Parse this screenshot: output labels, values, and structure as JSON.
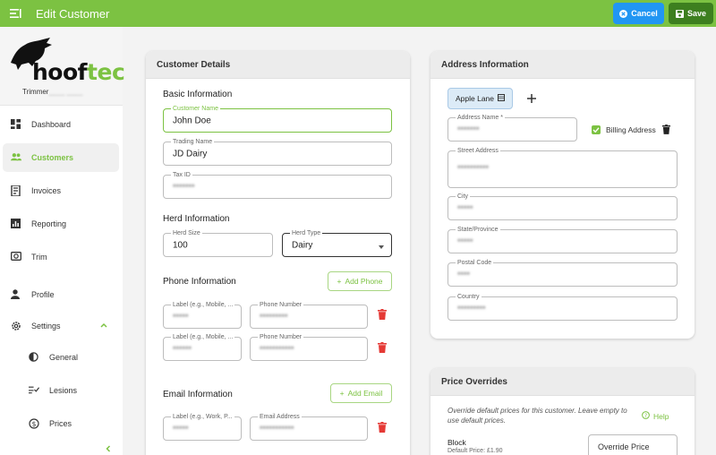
{
  "topbar": {
    "title": "Edit Customer",
    "cancel_label": "Cancel",
    "save_label": "Save"
  },
  "sidebar": {
    "logo_prefix": "hoof",
    "logo_suffix": "tec",
    "subtitle": "Trimmer",
    "items": [
      {
        "label": "Dashboard",
        "icon": "dashboard-icon"
      },
      {
        "label": "Customers",
        "icon": "people-icon",
        "active": true
      },
      {
        "label": "Invoices",
        "icon": "receipt-icon"
      },
      {
        "label": "Reporting",
        "icon": "chart-icon"
      },
      {
        "label": "Trim",
        "icon": "hoof-icon"
      },
      {
        "label": "Profile",
        "icon": "person-icon"
      },
      {
        "label": "Settings",
        "icon": "gear-icon"
      },
      {
        "label": "General",
        "icon": "contrast-icon"
      },
      {
        "label": "Lesions",
        "icon": "checklist-icon"
      },
      {
        "label": "Prices",
        "icon": "currency-icon"
      }
    ]
  },
  "customer": {
    "header": "Customer Details",
    "basic_title": "Basic Information",
    "name_label": "Customer Name",
    "name_value": "John Doe",
    "trading_label": "Trading Name",
    "trading_value": "JD Dairy",
    "tax_label": "Tax ID",
    "tax_value": "*******",
    "herd_title": "Herd Information",
    "herd_size_label": "Herd Size",
    "herd_size_value": "100",
    "herd_type_label": "Herd Type",
    "herd_type_value": "Dairy",
    "phone_title": "Phone Information",
    "add_phone": "Add Phone",
    "phone_label_label": "Label (e.g., Mobile, ...",
    "phone_number_label": "Phone Number",
    "phones": [
      {
        "label": "*****",
        "number": "*********"
      },
      {
        "label": "******",
        "number": "***********"
      }
    ],
    "email_title": "Email Information",
    "add_email": "Add Email",
    "email_label_label": "Label (e.g., Work, P...",
    "email_address_label": "Email Address",
    "emails": [
      {
        "label": "*****",
        "address": "***********"
      }
    ]
  },
  "address": {
    "header": "Address Information",
    "tab_label": "Apple Lane",
    "address_name_label": "Address Name *",
    "address_name_value": "*******",
    "billing_label": "Billing Address",
    "street_label": "Street Address",
    "street_value": "**********",
    "city_label": "City",
    "city_value": "*****",
    "state_label": "State/Province",
    "state_value": "*****",
    "postal_label": "Postal Code",
    "postal_value": "****",
    "country_label": "Country",
    "country_value": "*********"
  },
  "price": {
    "header": "Price Overrides",
    "note": "Override default prices for this customer. Leave empty to use default prices.",
    "help_label": "Help",
    "block_label": "Block",
    "block_default": "Default Price: £1.90",
    "override_placeholder": "Override Price"
  },
  "colors": {
    "brand_green": "#7cc242",
    "cancel_blue": "#2196f3",
    "save_green": "#3d7f1f",
    "delete_red": "#e53935"
  }
}
